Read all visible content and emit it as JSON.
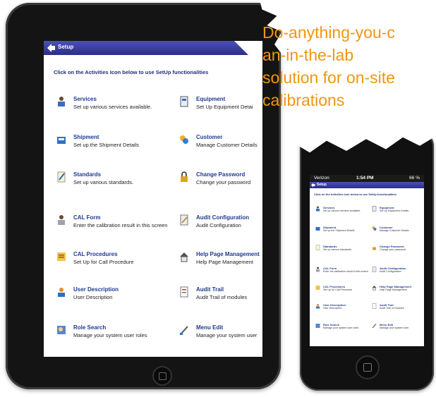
{
  "ipad_app": {
    "title": "Setup",
    "instruction": "Click on the Activities Icon below to use SetUp functionalities",
    "items": [
      {
        "title": "Services",
        "desc": "Set up various services available.",
        "icon": "services-icon"
      },
      {
        "title": "Equipment",
        "desc": "Set Up Equipment Detai",
        "icon": "equipment-icon"
      },
      {
        "title": "Shipment",
        "desc": "Set up the Shipment Details",
        "icon": "shipment-icon"
      },
      {
        "title": "Customer",
        "desc": "Manage Customer Details",
        "icon": "customer-icon"
      },
      {
        "title": "Standards",
        "desc": "Set up various standards.",
        "icon": "standards-icon"
      },
      {
        "title": "Change Password",
        "desc": "Change your password",
        "icon": "lock-icon"
      },
      {
        "title": "CAL Form",
        "desc": "Enter the calibration result in this screen",
        "icon": "cal-form-icon"
      },
      {
        "title": "Audit Configuration",
        "desc": "Audit Configuration",
        "icon": "audit-config-icon"
      },
      {
        "title": "CAL Procedures",
        "desc": "Set Up for Call Procedure",
        "icon": "cal-procedures-icon"
      },
      {
        "title": "Help Page Management",
        "desc": "Help Page Management",
        "icon": "help-page-icon"
      },
      {
        "title": "User Description",
        "desc": "User Description",
        "icon": "user-description-icon"
      },
      {
        "title": "Audit Trail",
        "desc": "Audit Trail of modules",
        "icon": "audit-trail-icon"
      },
      {
        "title": "Role Search",
        "desc": "Manage your system user roles",
        "icon": "role-search-icon"
      },
      {
        "title": "Menu Edit",
        "desc": "Manage your system user",
        "icon": "menu-edit-icon"
      }
    ]
  },
  "headline": {
    "line1": "Do-anything-you-c",
    "line2": "an-in-the-lab",
    "line3": "solution for on-site",
    "line4": "calibrations"
  },
  "iphone": {
    "carrier": "Verizon",
    "time": "1:54 PM",
    "battery": "66 %",
    "title": "Setup",
    "instruction": "Click on the Activities Icon below to use SetUp functionalities",
    "items": [
      {
        "title": "Services",
        "desc": "Set up various services available."
      },
      {
        "title": "Equipment",
        "desc": "Set Up Equipment Details"
      },
      {
        "title": "Shipment",
        "desc": "Set up the Shipment Details"
      },
      {
        "title": "Customer",
        "desc": "Manage Customer Details"
      },
      {
        "title": "Standards",
        "desc": "Set up various standards."
      },
      {
        "title": "Change Password",
        "desc": "Change your password"
      },
      {
        "title": "CAL Form",
        "desc": "Enter the calibration result in this screen"
      },
      {
        "title": "Audit Configuration",
        "desc": "Audit Configuration"
      },
      {
        "title": "CAL Procedures",
        "desc": "Set Up for Call Procedure"
      },
      {
        "title": "Help Page Management",
        "desc": "Help Page Management"
      },
      {
        "title": "User Description",
        "desc": "User Description"
      },
      {
        "title": "Audit Trail",
        "desc": "Audit Trail of modules"
      },
      {
        "title": "Role Search",
        "desc": "Manage your system user roles"
      },
      {
        "title": "Menu Edit",
        "desc": "Manage your system user"
      }
    ]
  },
  "colors": {
    "accent_orange": "#ef9614",
    "header_blue": "#3b3f9e",
    "link_blue": "#1f3a93"
  }
}
